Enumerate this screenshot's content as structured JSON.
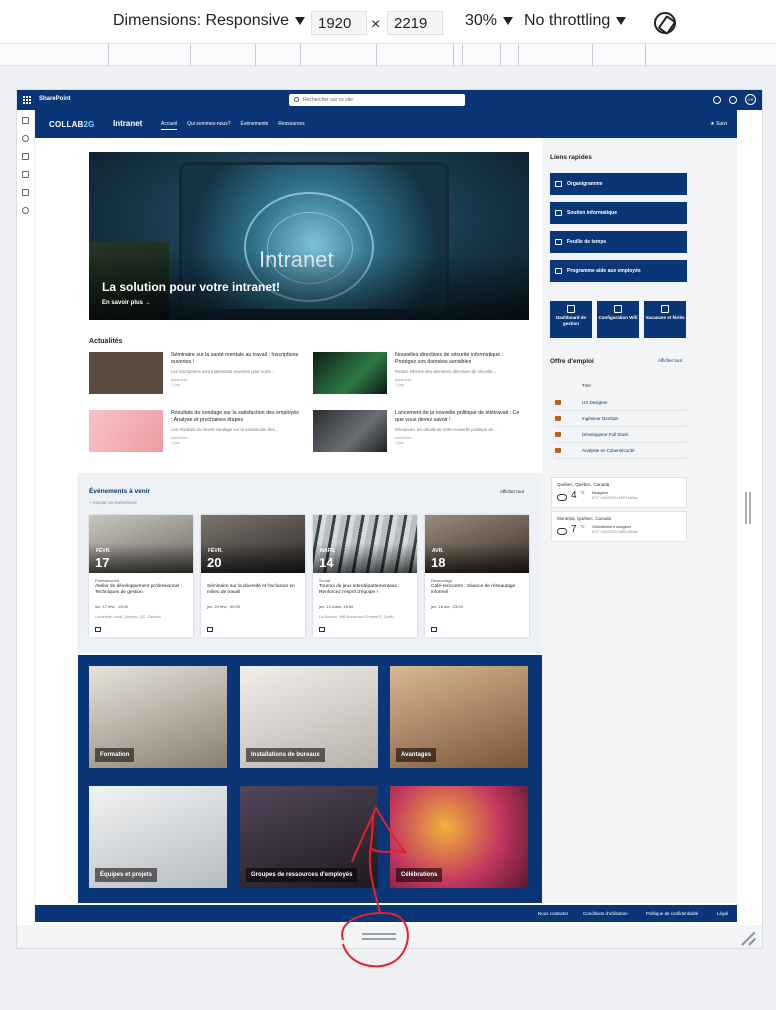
{
  "devtools": {
    "dimensions_label": "Dimensions: Responsive",
    "width": "1920",
    "times": "×",
    "height": "2219",
    "zoom": "30%",
    "throttling": "No throttling"
  },
  "suitebar": {
    "brand": "SharePoint",
    "search_placeholder": "Rechercher sur ce site",
    "avatar_initials": "GR"
  },
  "header": {
    "logo_main": "COLLAB",
    "logo_accent": "2G",
    "site_title": "Intranet",
    "nav": [
      "Accueil",
      "Qui sommes-nous?",
      "Événements",
      "Ressources"
    ],
    "follow": "★ Suivi"
  },
  "hero": {
    "screen_word": "Intranet",
    "title": "La solution pour votre intranet!",
    "link": "En savoir plus →"
  },
  "news": {
    "title": "Actualités",
    "items": [
      {
        "title": "Séminaire sur la santé mentale au travail : Inscriptions ouvertes !",
        "desc": "Les inscriptions sont maintenant ouvertes pour notre...",
        "author": "asset free",
        "age": "1 jour",
        "color": "#5b4a3f"
      },
      {
        "title": "Nouvelles directives de sécurité informatique : Protégez vos données sensibles",
        "desc": "Restez informé des dernières directives de sécurité...",
        "author": "asset free",
        "age": "1 jour",
        "color": "#1f3a2b"
      },
      {
        "title": "Résultats du sondage sur la satisfaction des employés : Analyse et prochaines étapes",
        "desc": "Les résultats du récent sondage sur la satisfaction des...",
        "author": "asset free",
        "age": "1 jour",
        "color": "#f3b7bd"
      },
      {
        "title": "Lancement de la nouvelle politique de télétravail : Ce que vous devez savoir !",
        "desc": "Découvrez les détails de notre nouvelle politique de...",
        "author": "asset free",
        "age": "1 jour",
        "color": "#3b3f45"
      }
    ]
  },
  "events": {
    "title": "Événements à venir",
    "add": "+ Ajouter un événement",
    "see_all": "Afficher tout",
    "items": [
      {
        "month": "FÉVR.",
        "day": "17",
        "category": "Professionnel",
        "title": "Atelier de développement professionnel : Techniques de gestion",
        "date": "lun. 17 févr., 13:00",
        "location": "Université Laval, Québec, QC, Canada",
        "color": "#6e6a62"
      },
      {
        "month": "FÉVR.",
        "day": "20",
        "category": "",
        "title": "Séminaire sur la diversité et l'inclusion en milieu de travail",
        "date": "jeu. 20 févr., 09:00",
        "location": "",
        "color": "#3d3a38"
      },
      {
        "month": "MARS",
        "day": "14",
        "category": "Social",
        "title": "Tournoi de jeux interdépartementaux : Renforcez l'esprit d'équipe !",
        "date": "jeu. 14 mars, 18:00",
        "location": "La Bouche, 986 Boulevard Charest E, Québ...",
        "color": "#8a9499"
      },
      {
        "month": "AVR.",
        "day": "18",
        "category": "Réseautage",
        "title": "Café-rencontre : Séance de réseautage informel",
        "date": "jeu. 18 avr., 23:00",
        "location": "",
        "color": "#4a3e35"
      }
    ]
  },
  "tiles": [
    {
      "label": "Formation",
      "color": "#b9b2a6"
    },
    {
      "label": "Installations de bureaux",
      "color": "#d7d4cf"
    },
    {
      "label": "Avantages",
      "color": "#a78466"
    },
    {
      "label": "Équipes et projets",
      "color": "#cfd3d6"
    },
    {
      "label": "Groupes de ressources d'employés",
      "color": "#3a3340"
    },
    {
      "label": "Célébrations",
      "color": "#9b3350"
    }
  ],
  "quick_links": {
    "title": "Liens rapides",
    "wide": [
      "Organigramme",
      "Soutien informatique",
      "Feuille de temps",
      "Programme aide aux employés"
    ],
    "square": [
      "Dashboard de gestion",
      "Configuration Wifi",
      "Vacances et fériés"
    ]
  },
  "jobs": {
    "title": "Offre d'emploi",
    "see_all": "Afficher tout",
    "column": "Titre",
    "items": [
      "UX Designer",
      "Ingénieur DevOps",
      "Développeur Full Stack",
      "Analyste en Cybersécurité"
    ]
  },
  "weather": [
    {
      "city": "Québec, Québec, Canada",
      "temp": "4",
      "unit": "°C",
      "cond": "Nuageux",
      "meta": "8°/1°      10/02/2024      MSN Météo"
    },
    {
      "city": "Montréal, Québec, Canada",
      "temp": "7",
      "unit": "°C",
      "cond": "Globalement nuageux",
      "meta": "8°/2°      10/02/2024      MSN Météo"
    }
  ],
  "footer": [
    "Nous contacter",
    "Conditions d'utilisation",
    "Politique de confidentialité",
    "Légal"
  ],
  "colors": {
    "brand": "#0a3678",
    "annotation": "#e5212b"
  }
}
